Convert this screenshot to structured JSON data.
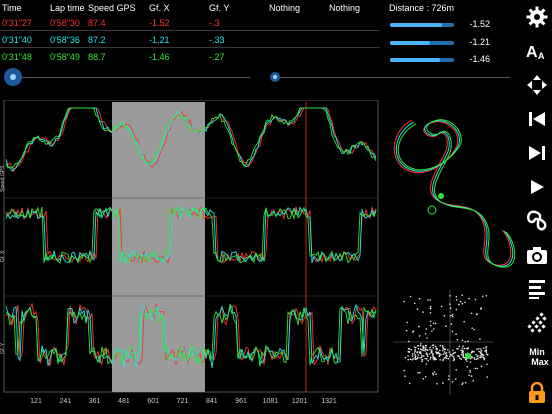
{
  "header": {
    "columns": [
      "Time",
      "Lap time",
      "Speed GPS",
      "Gf. X",
      "Gf. Y",
      "Nothing",
      "Nothing"
    ],
    "distance": "Distance : 726m"
  },
  "rows": [
    {
      "time": "0'31\"27",
      "lap_time": "0'58\"30",
      "speed": "87.4",
      "gfx": "-1.52",
      "gfy": "-.3",
      "color": "#ff3030"
    },
    {
      "time": "0'31\"40",
      "lap_time": "0'58\"36",
      "speed": "87.2",
      "gfx": "-1.21",
      "gfy": "-.33",
      "color": "#22e6e6"
    },
    {
      "time": "0'31\"48",
      "lap_time": "0'58\"49",
      "speed": "88.7",
      "gfx": "-1.46",
      "gfy": "-.27",
      "color": "#33e633"
    }
  ],
  "gauges": [
    {
      "value": "-1.52",
      "fill": 0.82,
      "color": "#ff3030"
    },
    {
      "value": "-1.21",
      "fill": 0.62,
      "color": "#22e6e6"
    },
    {
      "value": "-1.46",
      "fill": 0.78,
      "color": "#33e633"
    }
  ],
  "chart_labels": {
    "speed": "Speed GPS",
    "gfx": "Gf. X",
    "gfy": "Gf. Y"
  },
  "x_ticks": [
    "121",
    "241",
    "361",
    "481",
    "601",
    "721",
    "841",
    "961",
    "1081",
    "1201",
    "1321"
  ],
  "toolbar": [
    {
      "name": "settings-gear-icon"
    },
    {
      "name": "font-size-icon"
    },
    {
      "name": "zoom-arrows-icon"
    },
    {
      "name": "skip-back-icon"
    },
    {
      "name": "skip-forward-icon"
    },
    {
      "name": "play-icon"
    },
    {
      "name": "track-map-icon"
    },
    {
      "name": "camera-icon"
    },
    {
      "name": "list-icon"
    },
    {
      "name": "sectors-icon"
    },
    {
      "name": "min-max-icon",
      "label_top": "Min",
      "label_bottom": "Max"
    },
    {
      "name": "lock-icon"
    }
  ],
  "colors": {
    "red": "#ff3030",
    "cyan": "#22e6e6",
    "green": "#33e633",
    "accent": "#ff9a1a"
  }
}
